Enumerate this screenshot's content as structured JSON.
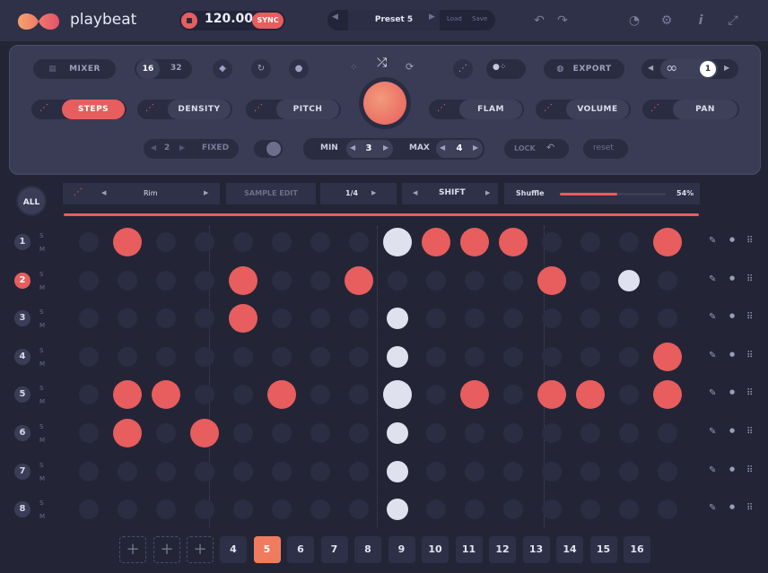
{
  "app": {
    "name": "playbeat"
  },
  "transport": {
    "bpm": "120.00",
    "sync": "SYNC"
  },
  "preset": {
    "name": "Preset 5",
    "load": "Load",
    "save": "Save"
  },
  "panel": {
    "mixer": "MIXER",
    "len16": "16",
    "len32": "32",
    "export": "EXPORT",
    "loop_count": "1",
    "steps": "STEPS",
    "density": "DENSITY",
    "pitch": "PITCH",
    "flam": "FLAM",
    "volume": "VOLUME",
    "pan": "PAN",
    "fixed_val": "2",
    "fixed": "FIXED",
    "min": "MIN",
    "min_val": "3",
    "max": "MAX",
    "max_val": "4",
    "lock": "LOCK",
    "reset": "reset"
  },
  "controls": {
    "all": "ALL",
    "sample": "Rim",
    "sample_edit": "SAMPLE EDIT",
    "rate": "1/4",
    "shift": "SHIFT",
    "shuffle": "Shuffle",
    "shuffle_val": "54%",
    "shuffle_amount": 0.54
  },
  "rows": [
    {
      "num": "1",
      "active": false,
      "cells": [
        0,
        1,
        0,
        0,
        0,
        0,
        0,
        0,
        2,
        1,
        1,
        1,
        0,
        0,
        0,
        1
      ]
    },
    {
      "num": "2",
      "active": true,
      "cells": [
        0,
        0,
        0,
        0,
        1,
        0,
        0,
        1,
        0,
        0,
        0,
        0,
        1,
        0,
        2,
        0
      ]
    },
    {
      "num": "3",
      "active": false,
      "cells": [
        0,
        0,
        0,
        0,
        1,
        0,
        0,
        0,
        2,
        0,
        0,
        0,
        0,
        0,
        0,
        0
      ]
    },
    {
      "num": "4",
      "active": false,
      "cells": [
        0,
        0,
        0,
        0,
        0,
        0,
        0,
        0,
        2,
        0,
        0,
        0,
        0,
        0,
        0,
        1
      ]
    },
    {
      "num": "5",
      "active": false,
      "cells": [
        0,
        1,
        1,
        0,
        0,
        1,
        0,
        0,
        2,
        0,
        1,
        0,
        1,
        1,
        0,
        1
      ]
    },
    {
      "num": "6",
      "active": false,
      "cells": [
        0,
        1,
        0,
        1,
        0,
        0,
        0,
        0,
        2,
        0,
        0,
        0,
        0,
        0,
        0,
        0
      ]
    },
    {
      "num": "7",
      "active": false,
      "cells": [
        0,
        0,
        0,
        0,
        0,
        0,
        0,
        0,
        2,
        0,
        0,
        0,
        0,
        0,
        0,
        0
      ]
    },
    {
      "num": "8",
      "active": false,
      "cells": [
        0,
        0,
        0,
        0,
        0,
        0,
        0,
        0,
        2,
        0,
        0,
        0,
        0,
        0,
        0,
        0
      ]
    }
  ],
  "row_s": "S",
  "row_m": "M",
  "pages": [
    "4",
    "5",
    "6",
    "7",
    "8",
    "9",
    "10",
    "11",
    "12",
    "13",
    "14",
    "15",
    "16"
  ],
  "active_page": "5",
  "colors": {
    "accent": "#e85d5d",
    "light": "#dfe2ee",
    "bg": "#232536"
  }
}
